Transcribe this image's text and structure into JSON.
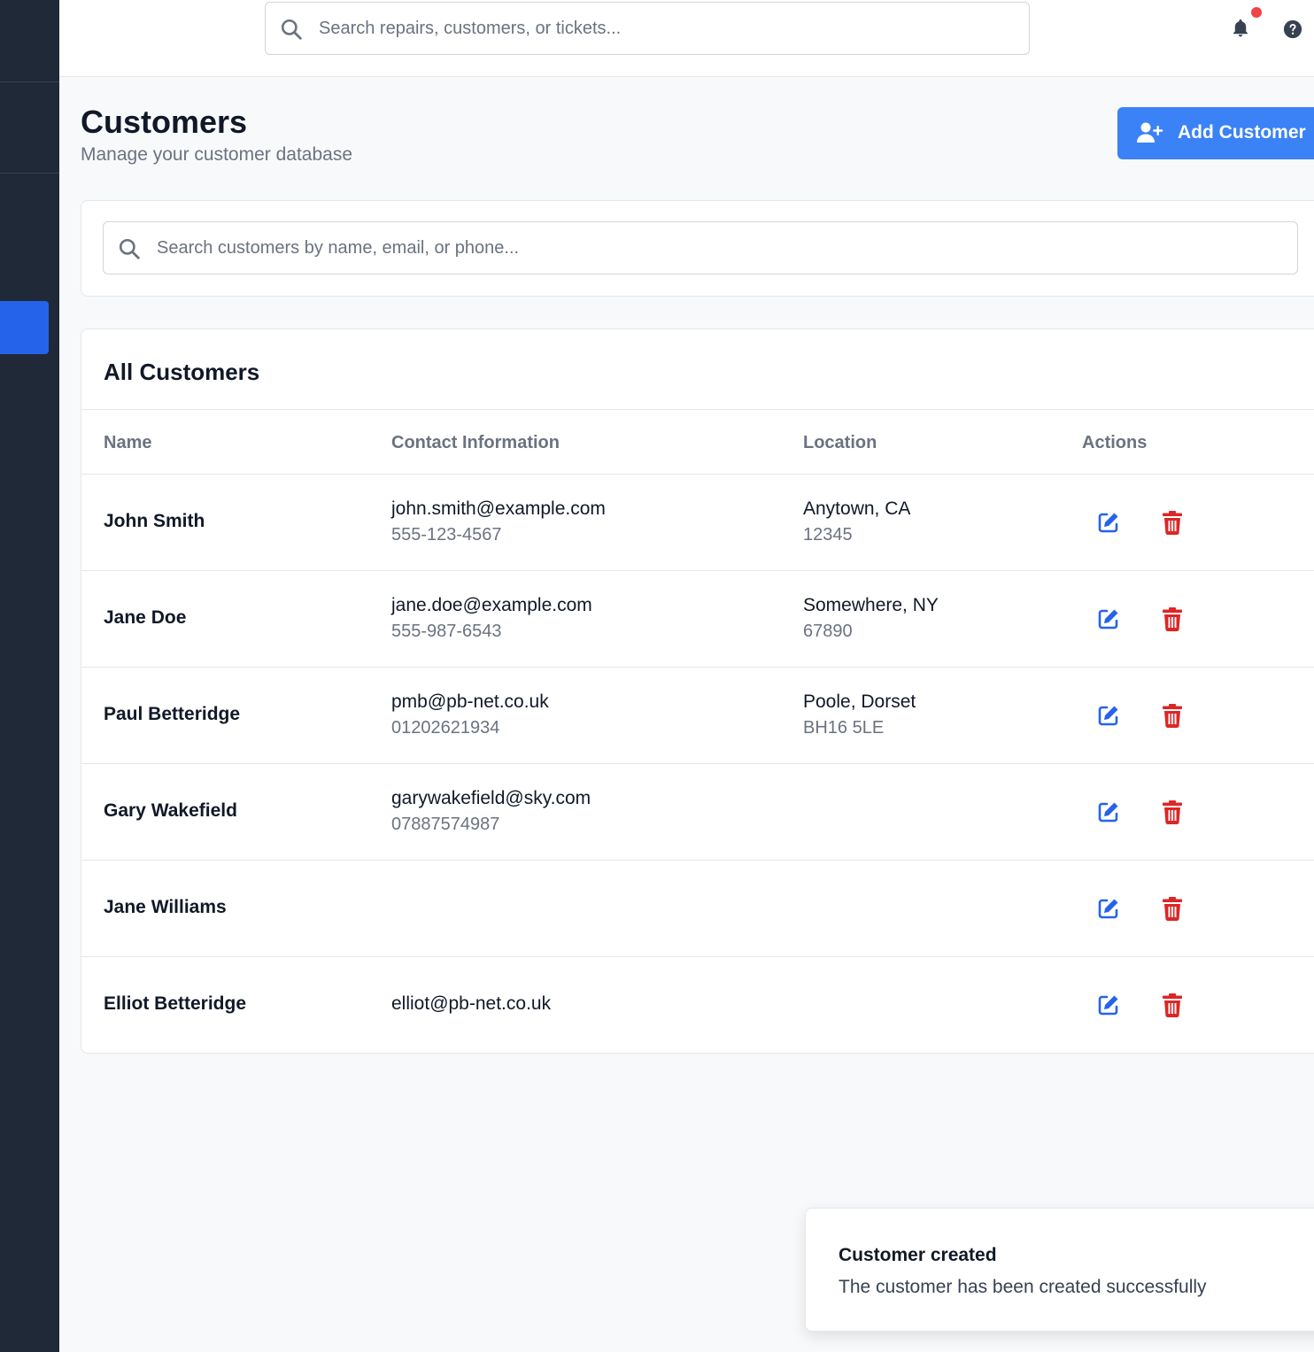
{
  "topbar": {
    "search_placeholder": "Search repairs, customers, or tickets...",
    "icons": [
      "search-icon",
      "bell-icon",
      "help-icon"
    ],
    "notification_dot_color": "#ef4444"
  },
  "header": {
    "title": "Customers",
    "subtitle": "Manage your customer database",
    "add_button_label": "Add Customer",
    "add_button_icon": "user-plus-icon"
  },
  "customer_search": {
    "placeholder": "Search customers by name, email, or phone..."
  },
  "table": {
    "title": "All Customers",
    "columns": {
      "name": "Name",
      "contact": "Contact Information",
      "location": "Location",
      "actions": "Actions"
    },
    "rows": [
      {
        "name": "John Smith",
        "email": "john.smith@example.com",
        "phone": "555-123-4567",
        "city": "Anytown, CA",
        "zip": "12345"
      },
      {
        "name": "Jane Doe",
        "email": "jane.doe@example.com",
        "phone": "555-987-6543",
        "city": "Somewhere, NY",
        "zip": "67890"
      },
      {
        "name": "Paul Betteridge",
        "email": "pmb@pb-net.co.uk",
        "phone": "01202621934",
        "city": "Poole, Dorset",
        "zip": "BH16 5LE"
      },
      {
        "name": "Gary Wakefield",
        "email": "garywakefield@sky.com",
        "phone": "07887574987",
        "city": "",
        "zip": ""
      },
      {
        "name": "Jane Williams",
        "email": "",
        "phone": "",
        "city": "",
        "zip": ""
      },
      {
        "name": "Elliot Betteridge",
        "email": "elliot@pb-net.co.uk",
        "phone": "",
        "city": "",
        "zip": ""
      }
    ],
    "row_icons": [
      "edit-icon",
      "trash-icon"
    ]
  },
  "toast": {
    "title": "Customer created",
    "description": "The customer has been created successfully"
  },
  "colors": {
    "sidebar": "#1f2937",
    "primary": "#3b82f6",
    "sidebar_active": "#2563eb",
    "edit": "#2563eb",
    "delete": "#dc2626"
  }
}
